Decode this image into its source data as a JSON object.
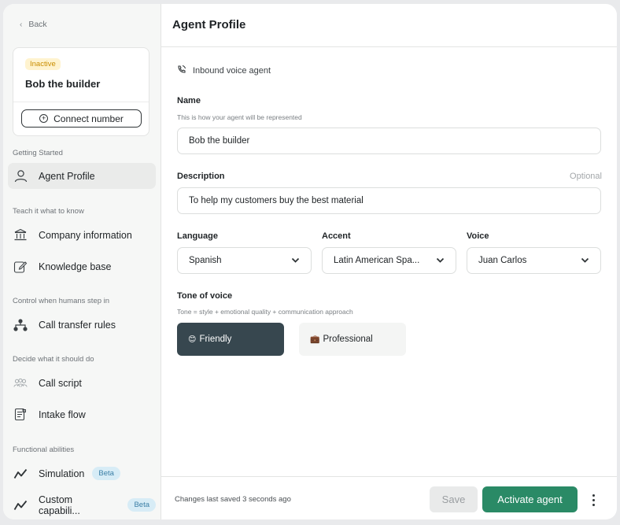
{
  "sidebar": {
    "back_label": "Back",
    "agent_status": "Inactive",
    "agent_name": "Bob the builder",
    "connect_label": "Connect number",
    "sections": {
      "getting_started": "Getting Started",
      "teach": "Teach it what to know",
      "control": "Control when humans step in",
      "decide": "Decide what it should do",
      "functional": "Functional abilities"
    },
    "items": {
      "agent_profile": "Agent Profile",
      "company_info": "Company information",
      "knowledge_base": "Knowledge base",
      "call_transfer": "Call transfer rules",
      "call_script": "Call script",
      "intake_flow": "Intake flow",
      "simulation": "Simulation",
      "custom_capabilities": "Custom capabili...",
      "beta_label": "Beta"
    }
  },
  "header": {
    "title": "Agent Profile"
  },
  "form": {
    "agent_type": "Inbound voice agent",
    "name": {
      "label": "Name",
      "help": "This is how your agent will be represented",
      "value": "Bob the builder"
    },
    "description": {
      "label": "Description",
      "optional": "Optional",
      "value": "To help my customers buy the best material"
    },
    "language": {
      "label": "Language",
      "value": "Spanish"
    },
    "accent": {
      "label": "Accent",
      "value": "Latin American Spa..."
    },
    "voice": {
      "label": "Voice",
      "value": "Juan Carlos"
    },
    "tone": {
      "label": "Tone of voice",
      "help": "Tone = style + emotional quality + communication approach",
      "options": [
        {
          "emoji": "😊",
          "label": "Friendly",
          "selected": true
        },
        {
          "emoji": "💼",
          "label": "Professional",
          "selected": false
        }
      ]
    }
  },
  "footer": {
    "saved_text": "Changes last saved 3 seconds ago",
    "save_label": "Save",
    "activate_label": "Activate agent"
  },
  "colors": {
    "accent_green": "#2a8a66",
    "tone_selected": "#37474f",
    "inactive_badge_bg": "#fff3cf",
    "inactive_badge_text": "#c98d00",
    "beta_bg": "#d7ecf6"
  }
}
